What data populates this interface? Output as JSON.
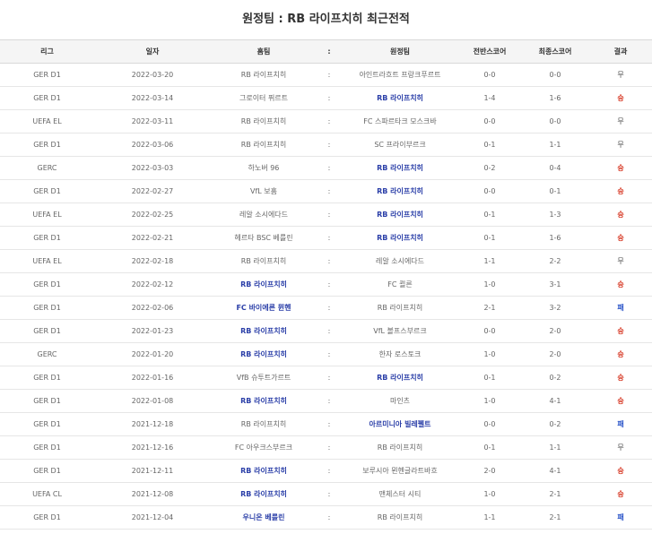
{
  "page_title": "원정팀 : RB 라이프치히 최근전적",
  "headers": [
    "리그",
    "일자",
    "홈팀",
    ":",
    "원정팀",
    "전반스코어",
    "최종스코어",
    "결과"
  ],
  "highlight_color": "#2b3fa8",
  "rows": [
    {
      "league": "GER D1",
      "date": "2022-03-20",
      "home": "RB 라이프치히",
      "sep": ":",
      "away": "아인트라흐트 프랑크푸르트",
      "half": "0-0",
      "final": "0-0",
      "result": "무",
      "hl": "none",
      "rc": "draw"
    },
    {
      "league": "GER D1",
      "date": "2022-03-14",
      "home": "그로이터 퓌르트",
      "sep": ":",
      "away": "RB 라이프치히",
      "half": "1-4",
      "final": "1-6",
      "result": "승",
      "hl": "away",
      "rc": "win"
    },
    {
      "league": "UEFA EL",
      "date": "2022-03-11",
      "home": "RB 라이프치히",
      "sep": ":",
      "away": "FC 스파르타크 모스크바",
      "half": "0-0",
      "final": "0-0",
      "result": "무",
      "hl": "none",
      "rc": "draw"
    },
    {
      "league": "GER D1",
      "date": "2022-03-06",
      "home": "RB 라이프치히",
      "sep": ":",
      "away": "SC 프라이부르크",
      "half": "0-1",
      "final": "1-1",
      "result": "무",
      "hl": "none",
      "rc": "draw"
    },
    {
      "league": "GERC",
      "date": "2022-03-03",
      "home": "하노버 96",
      "sep": ":",
      "away": "RB 라이프치히",
      "half": "0-2",
      "final": "0-4",
      "result": "승",
      "hl": "away",
      "rc": "win"
    },
    {
      "league": "GER D1",
      "date": "2022-02-27",
      "home": "VfL 보훔",
      "sep": ":",
      "away": "RB 라이프치히",
      "half": "0-0",
      "final": "0-1",
      "result": "승",
      "hl": "away",
      "rc": "win"
    },
    {
      "league": "UEFA EL",
      "date": "2022-02-25",
      "home": "레알 소시에다드",
      "sep": ":",
      "away": "RB 라이프치히",
      "half": "0-1",
      "final": "1-3",
      "result": "승",
      "hl": "away",
      "rc": "win"
    },
    {
      "league": "GER D1",
      "date": "2022-02-21",
      "home": "헤르타 BSC 베를린",
      "sep": ":",
      "away": "RB 라이프치히",
      "half": "0-1",
      "final": "1-6",
      "result": "승",
      "hl": "away",
      "rc": "win"
    },
    {
      "league": "UEFA EL",
      "date": "2022-02-18",
      "home": "RB 라이프치히",
      "sep": ":",
      "away": "레알 소시에다드",
      "half": "1-1",
      "final": "2-2",
      "result": "무",
      "hl": "none",
      "rc": "draw"
    },
    {
      "league": "GER D1",
      "date": "2022-02-12",
      "home": "RB 라이프치히",
      "sep": ":",
      "away": "FC 쾰른",
      "half": "1-0",
      "final": "3-1",
      "result": "승",
      "hl": "home",
      "rc": "win"
    },
    {
      "league": "GER D1",
      "date": "2022-02-06",
      "home": "FC 바이에른 뮌헨",
      "sep": ":",
      "away": "RB 라이프치히",
      "half": "2-1",
      "final": "3-2",
      "result": "패",
      "hl": "home",
      "rc": "lose"
    },
    {
      "league": "GER D1",
      "date": "2022-01-23",
      "home": "RB 라이프치히",
      "sep": ":",
      "away": "VfL 볼프스부르크",
      "half": "0-0",
      "final": "2-0",
      "result": "승",
      "hl": "home",
      "rc": "win"
    },
    {
      "league": "GERC",
      "date": "2022-01-20",
      "home": "RB 라이프치히",
      "sep": ":",
      "away": "한자 로스토크",
      "half": "1-0",
      "final": "2-0",
      "result": "승",
      "hl": "home",
      "rc": "win"
    },
    {
      "league": "GER D1",
      "date": "2022-01-16",
      "home": "VfB 슈투트가르트",
      "sep": ":",
      "away": "RB 라이프치히",
      "half": "0-1",
      "final": "0-2",
      "result": "승",
      "hl": "away",
      "rc": "win"
    },
    {
      "league": "GER D1",
      "date": "2022-01-08",
      "home": "RB 라이프치히",
      "sep": ":",
      "away": "마인츠",
      "half": "1-0",
      "final": "4-1",
      "result": "승",
      "hl": "home",
      "rc": "win"
    },
    {
      "league": "GER D1",
      "date": "2021-12-18",
      "home": "RB 라이프치히",
      "sep": ":",
      "away": "아르미니아 빌레펠트",
      "half": "0-0",
      "final": "0-2",
      "result": "패",
      "hl": "away",
      "rc": "lose"
    },
    {
      "league": "GER D1",
      "date": "2021-12-16",
      "home": "FC 아우크스부르크",
      "sep": ":",
      "away": "RB 라이프치히",
      "half": "0-1",
      "final": "1-1",
      "result": "무",
      "hl": "none",
      "rc": "draw"
    },
    {
      "league": "GER D1",
      "date": "2021-12-11",
      "home": "RB 라이프치히",
      "sep": ":",
      "away": "보루시아 묀헨글라트바흐",
      "half": "2-0",
      "final": "4-1",
      "result": "승",
      "hl": "home",
      "rc": "win"
    },
    {
      "league": "UEFA CL",
      "date": "2021-12-08",
      "home": "RB 라이프치히",
      "sep": ":",
      "away": "맨체스터 시티",
      "half": "1-0",
      "final": "2-1",
      "result": "승",
      "hl": "home",
      "rc": "win"
    },
    {
      "league": "GER D1",
      "date": "2021-12-04",
      "home": "우니온 베를린",
      "sep": ":",
      "away": "RB 라이프치히",
      "half": "1-1",
      "final": "2-1",
      "result": "패",
      "hl": "home",
      "rc": "lose"
    }
  ]
}
